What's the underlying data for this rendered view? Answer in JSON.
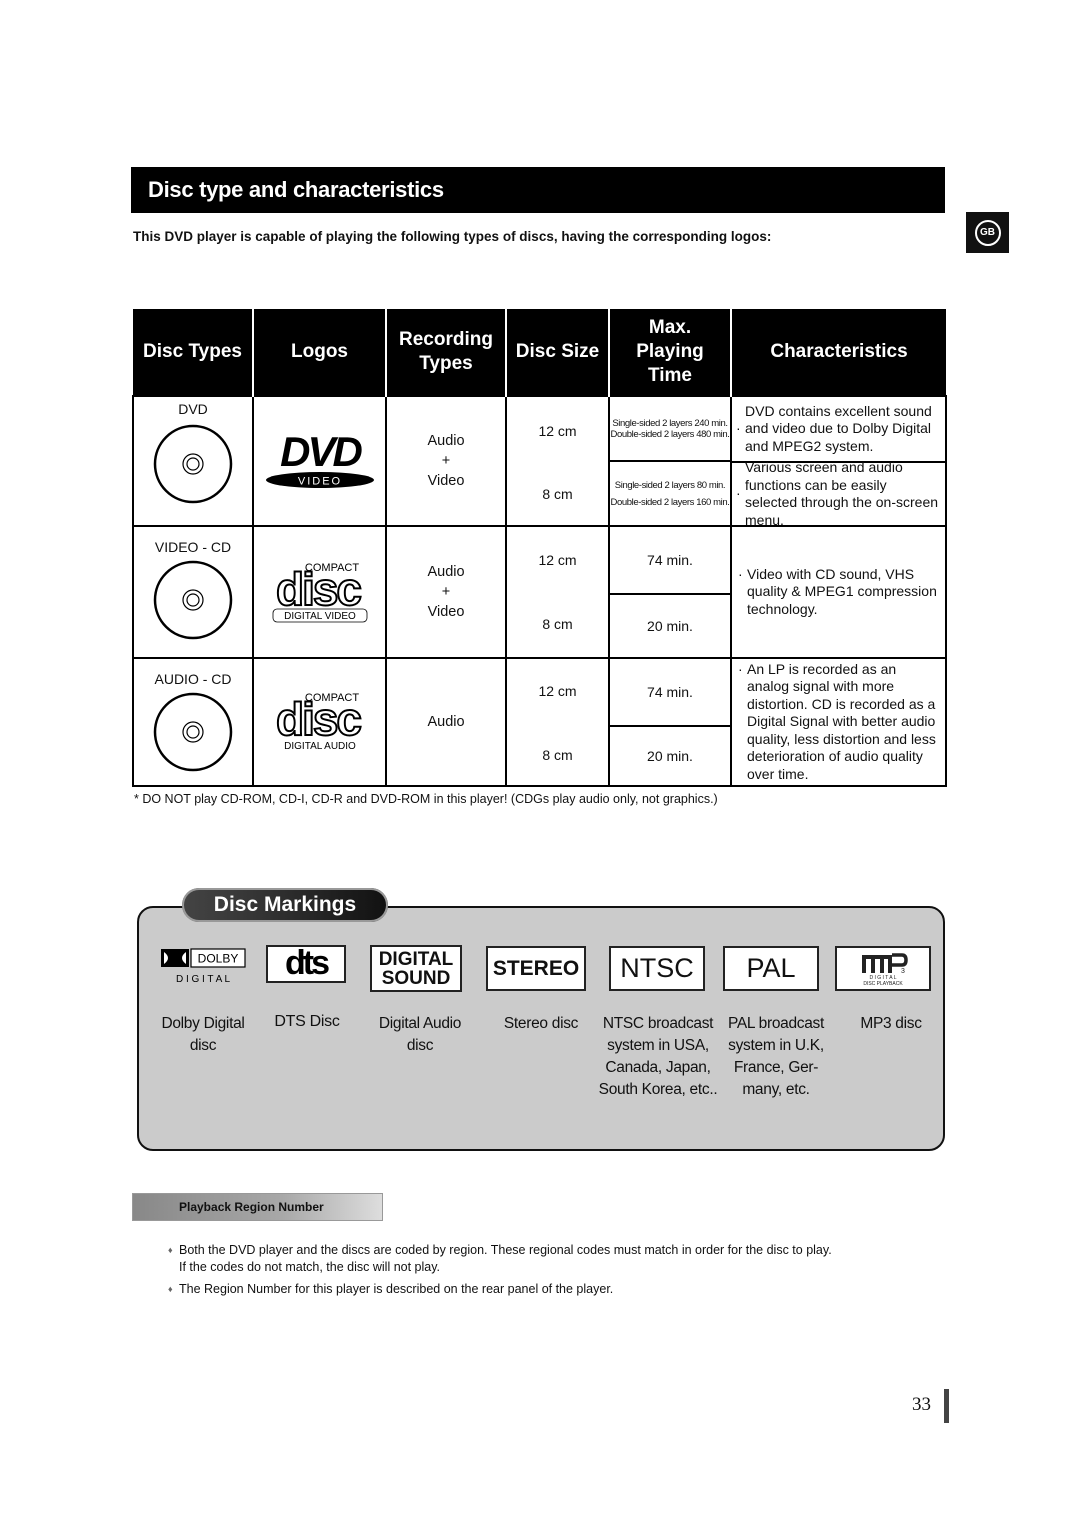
{
  "header": {
    "title": "Disc type and characteristics",
    "intro": "This DVD player is capable of playing the following types of discs, having the corresponding logos:",
    "language_badge": "GB"
  },
  "table": {
    "columns": [
      "Disc Types",
      "Logos",
      "Recording Types",
      "Disc Size",
      "Max. Playing Time",
      "Characteristics"
    ],
    "column_lines": {
      "recording": [
        "Recording",
        "Types"
      ],
      "playing": [
        "Max.",
        "Playing",
        "Time"
      ]
    },
    "rows": [
      {
        "disc_type": "DVD",
        "logo": {
          "main": "DVD",
          "sub": "VIDEO"
        },
        "recording": [
          "Audio",
          "+",
          "Video"
        ],
        "sizes": [
          "12 cm",
          "8 cm"
        ],
        "times": [
          [
            "Single-sided 2 layers 240 min.",
            "Double-sided 2 layers 480 min."
          ],
          [
            "Single-sided 2 layers 80 min.",
            "Double-sided 2 layers 160 min."
          ]
        ],
        "characteristics": [
          "DVD contains excellent sound and video due to Dolby Digital and MPEG2 system.",
          "Various screen and audio functions can be easily selected through the on-screen menu."
        ]
      },
      {
        "disc_type": "VIDEO - CD",
        "logo": {
          "top": "COMPACT",
          "main": "disc",
          "sub": "DIGITAL VIDEO"
        },
        "recording": [
          "Audio",
          "+",
          "Video"
        ],
        "sizes": [
          "12 cm",
          "8 cm"
        ],
        "times": [
          "74 min.",
          "20 min."
        ],
        "characteristics": [
          "Video with CD sound, VHS quality & MPEG1 compression technology."
        ]
      },
      {
        "disc_type": "AUDIO - CD",
        "logo": {
          "top": "COMPACT",
          "main": "disc",
          "sub": "DIGITAL AUDIO"
        },
        "recording": [
          "Audio"
        ],
        "sizes": [
          "12 cm",
          "8 cm"
        ],
        "times": [
          "74 min.",
          "20 min."
        ],
        "characteristics": [
          "An LP is recorded as an analog signal with more distortion. CD is recorded as a Digital Signal with better audio quality, less distortion and less deterioration of audio quality over time."
        ]
      }
    ],
    "bullet": "·"
  },
  "footnote": "* DO NOT play CD-ROM, CD-I, CD-R and DVD-ROM in this player! (CDGs play audio only, not graphics.)",
  "markings": {
    "title": "Disc Markings",
    "items": [
      {
        "logo": "DOLBY",
        "logo_sub": "D I G I T A L",
        "caption": [
          "Dolby Digital",
          "disc"
        ]
      },
      {
        "logo": "dts",
        "caption": [
          "DTS Disc"
        ]
      },
      {
        "logo": "DIGITAL",
        "logo_sub": "SOUND",
        "caption": [
          "Digital Audio",
          "disc"
        ]
      },
      {
        "logo": "STEREO",
        "caption": [
          "Stereo disc"
        ]
      },
      {
        "logo": "NTSC",
        "caption": [
          "NTSC broadcast",
          "system in USA,",
          "Canada, Japan,",
          "South Korea, etc.."
        ]
      },
      {
        "logo": "PAL",
        "caption": [
          "PAL broadcast",
          "system in U.K,",
          "France, Ger-",
          "many, etc."
        ]
      },
      {
        "logo": "mp3",
        "logo_sub": "D I G I T A L",
        "logo_sub2": "DISC PLAYBACK",
        "caption": [
          "MP3 disc"
        ]
      }
    ]
  },
  "region": {
    "title": "Playback Region Number",
    "bullets": [
      [
        "Both the DVD player and the discs are coded by region. These regional codes must match in order for the disc to play.",
        "If the codes do not match, the disc will not play."
      ],
      [
        "The Region Number for this player is described on the rear panel of the player."
      ]
    ],
    "bullet_glyph": "♦"
  },
  "page_number": "33"
}
